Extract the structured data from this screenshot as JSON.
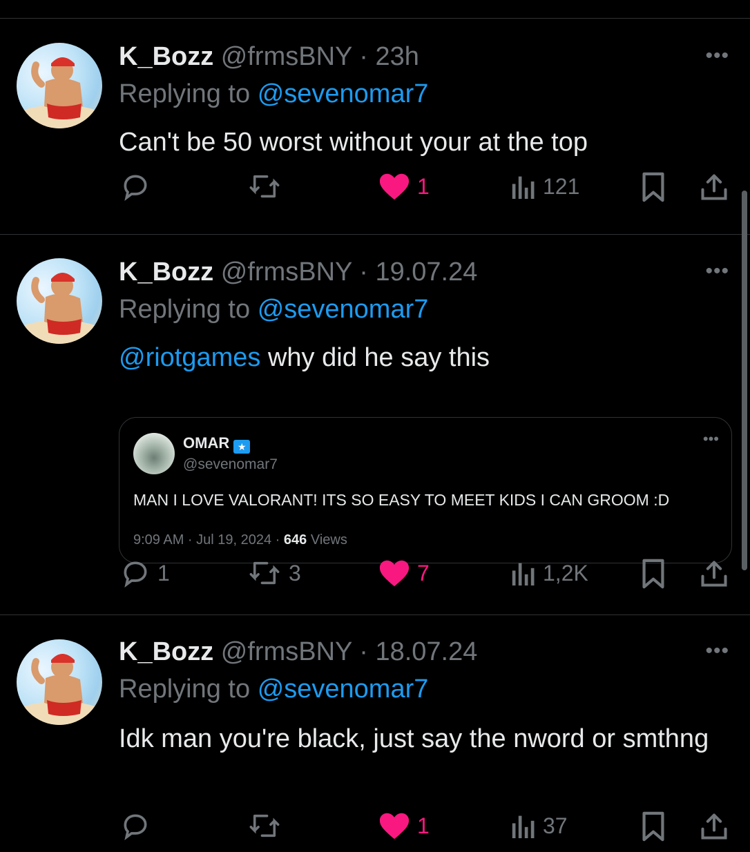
{
  "tweets": [
    {
      "display_name": "K_Bozz",
      "handle": "@frmsBNY",
      "separator": "·",
      "time": "23h",
      "replying_prefix": "Replying to",
      "replying_to": "@sevenomar7",
      "text": "Can't be 50 worst without your at the top",
      "text_mention": "",
      "more": "•••",
      "actions": {
        "replies": "",
        "retweets": "",
        "likes": "1",
        "views": "121",
        "liked": true
      }
    },
    {
      "display_name": "K_Bozz",
      "handle": "@frmsBNY",
      "separator": "·",
      "time": "19.07.24",
      "replying_prefix": "Replying to",
      "replying_to": "@sevenomar7",
      "text_mention": "@riotgames",
      "text": " why did he say this",
      "more": "•••",
      "quote": {
        "name": "OMAR",
        "badge": "★",
        "handle": "@sevenomar7",
        "more": "•••",
        "text": "MAN I LOVE VALORANT! ITS SO EASY TO MEET KIDS I CAN GROOM :D",
        "time": "9:09 AM · Jul 19, 2024 · ",
        "views_count": "646",
        "views_label": " Views"
      },
      "actions": {
        "replies": "1",
        "retweets": "3",
        "likes": "7",
        "views": "1,2K",
        "liked": true
      }
    },
    {
      "display_name": "K_Bozz",
      "handle": "@frmsBNY",
      "separator": "·",
      "time": "18.07.24",
      "replying_prefix": "Replying to",
      "replying_to": "@sevenomar7",
      "text_mention": "",
      "text": "Idk man you're black, just say the nword or smthng",
      "more": "•••",
      "actions": {
        "replies": "",
        "retweets": "",
        "likes": "1",
        "views": "37",
        "liked": true
      }
    }
  ],
  "colors": {
    "background": "#000000",
    "text": "#e7e9ea",
    "muted": "#71767b",
    "link": "#1d9bf0",
    "like": "#f91880",
    "divider": "#2f3336"
  },
  "icons": [
    "reply-icon",
    "retweet-icon",
    "heart-icon",
    "views-icon",
    "bookmark-icon",
    "share-icon",
    "more-icon"
  ]
}
